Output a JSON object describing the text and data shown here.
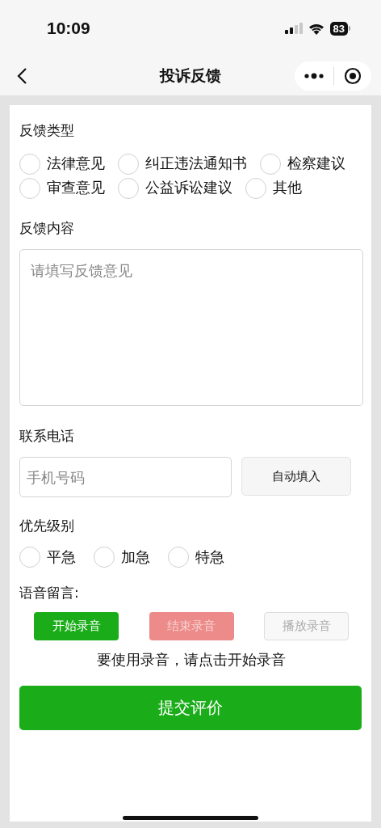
{
  "status_bar": {
    "time": "10:09",
    "battery": "83"
  },
  "nav": {
    "title": "投诉反馈"
  },
  "feedback_type": {
    "label": "反馈类型",
    "options": [
      {
        "label": "法律意见",
        "selected": false
      },
      {
        "label": "纠正违法通知书",
        "selected": false
      },
      {
        "label": "检察建议",
        "selected": false
      },
      {
        "label": "审查意见",
        "selected": false
      },
      {
        "label": "公益诉讼建议",
        "selected": false
      },
      {
        "label": "其他",
        "selected": false
      }
    ]
  },
  "content": {
    "label": "反馈内容",
    "placeholder": "请填写反馈意见"
  },
  "phone": {
    "label": "联系电话",
    "placeholder": "手机号码",
    "button": "自动填入"
  },
  "priority": {
    "label": "优先级别",
    "options": [
      {
        "label": "平急",
        "selected": false
      },
      {
        "label": "加急",
        "selected": false
      },
      {
        "label": "特急",
        "selected": false
      }
    ]
  },
  "voice": {
    "label": "语音留言:",
    "buttons": [
      {
        "label": "开始录音",
        "kind": "primary",
        "disabled": false
      },
      {
        "label": "结束录音",
        "kind": "warn",
        "disabled": true
      },
      {
        "label": "播放录音",
        "kind": "default",
        "disabled": true
      }
    ],
    "hint": "要使用录音，请点击开始录音"
  },
  "submit": "提交评价"
}
